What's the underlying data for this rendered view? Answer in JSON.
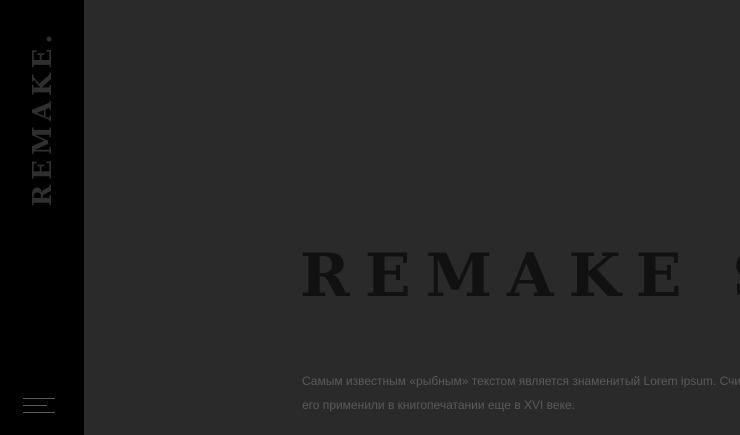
{
  "sidebar": {
    "brand": "REMAKE.",
    "menu_icon": "hamburger-menu-icon"
  },
  "hero": {
    "title": "REMAKE SALO",
    "text_line_1": "Самым известным «рыбным» текстом является знаменитый Lorem ipsum. Счит",
    "text_line_2": "его применили в книгопечатании еще в XVI веке."
  },
  "colors": {
    "sidebar_bg": "#000000",
    "page_bg": "#2a2a2a",
    "title": "#111111",
    "body_text": "#5a5a5a"
  }
}
